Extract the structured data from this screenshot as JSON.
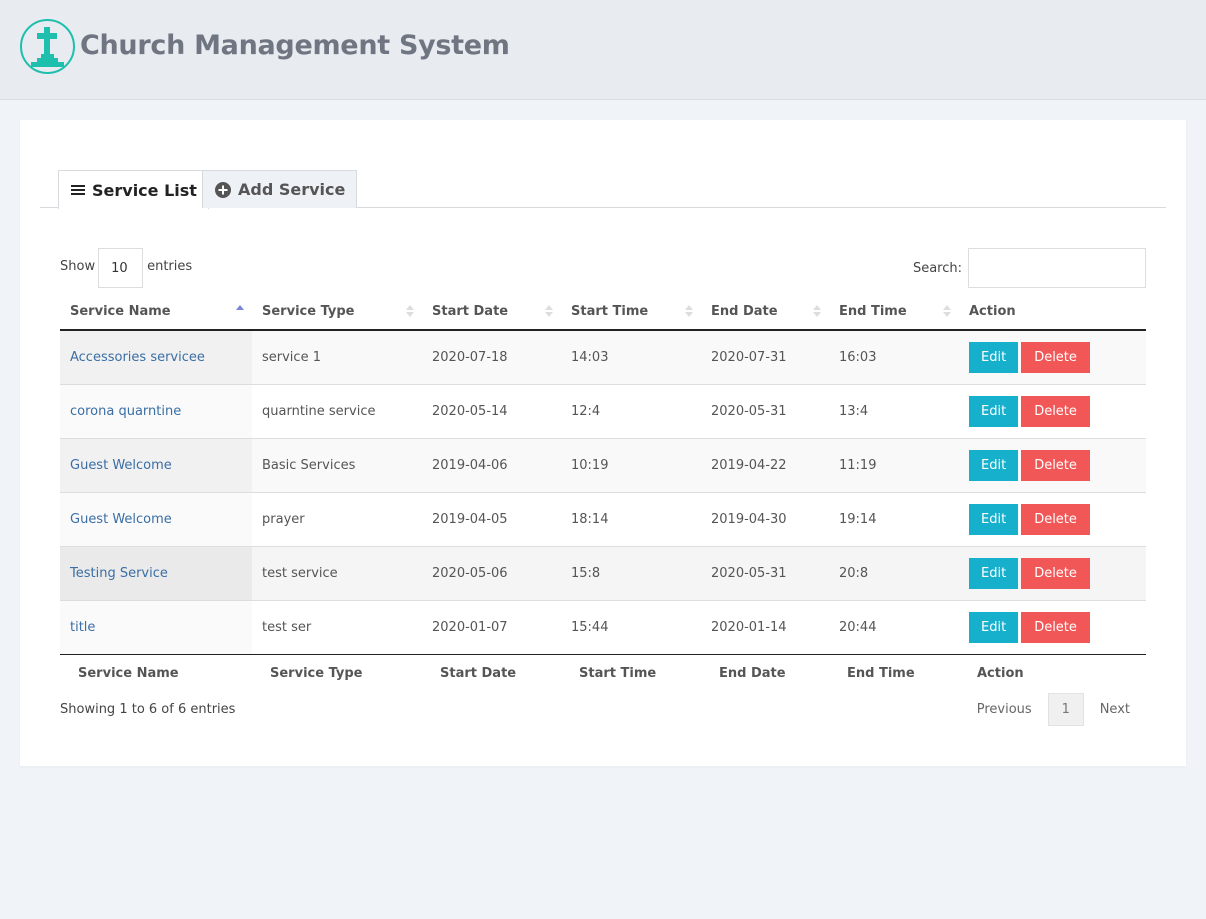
{
  "header": {
    "logo_icon": "church-cross-icon",
    "title": "Church Management System",
    "brand_color": "#1fbfad"
  },
  "tabs": [
    {
      "label": "Service List",
      "icon": "list-icon",
      "active": true
    },
    {
      "label": "Add Service",
      "icon": "plus-circle-icon",
      "active": false
    }
  ],
  "controls": {
    "show_label": "Show",
    "entries_value": "10",
    "entries_label": "entries",
    "search_label": "Search:",
    "search_value": "",
    "search_placeholder": ""
  },
  "table": {
    "columns": [
      "Service Name",
      "Service Type",
      "Start Date",
      "Start Time",
      "End Date",
      "End Time",
      "Action"
    ],
    "sorted_column": "Service Name",
    "sort_direction": "ascending",
    "rows": [
      {
        "name": "Accessories servicee",
        "type": "service 1",
        "start_date": "2020-07-18",
        "start_time": "14:03",
        "end_date": "2020-07-31",
        "end_time": "16:03"
      },
      {
        "name": "corona quarntine",
        "type": "quarntine service",
        "start_date": "2020-05-14",
        "start_time": "12:4",
        "end_date": "2020-05-31",
        "end_time": "13:4"
      },
      {
        "name": "Guest Welcome",
        "type": "Basic Services",
        "start_date": "2019-04-06",
        "start_time": "10:19",
        "end_date": "2019-04-22",
        "end_time": "11:19"
      },
      {
        "name": "Guest Welcome",
        "type": "prayer",
        "start_date": "2019-04-05",
        "start_time": "18:14",
        "end_date": "2019-04-30",
        "end_time": "19:14"
      },
      {
        "name": "Testing Service",
        "type": "test service",
        "start_date": "2020-05-06",
        "start_time": "15:8",
        "end_date": "2020-05-31",
        "end_time": "20:8"
      },
      {
        "name": "title",
        "type": "test ser",
        "start_date": "2020-01-07",
        "start_time": "15:44",
        "end_date": "2020-01-14",
        "end_time": "20:44"
      }
    ],
    "edit_label": "Edit",
    "delete_label": "Delete",
    "edit_color": "#17b0cc",
    "delete_color": "#f25757"
  },
  "footer": {
    "info": "Showing 1 to 6 of 6 entries",
    "previous": "Previous",
    "current_page": "1",
    "next": "Next"
  }
}
